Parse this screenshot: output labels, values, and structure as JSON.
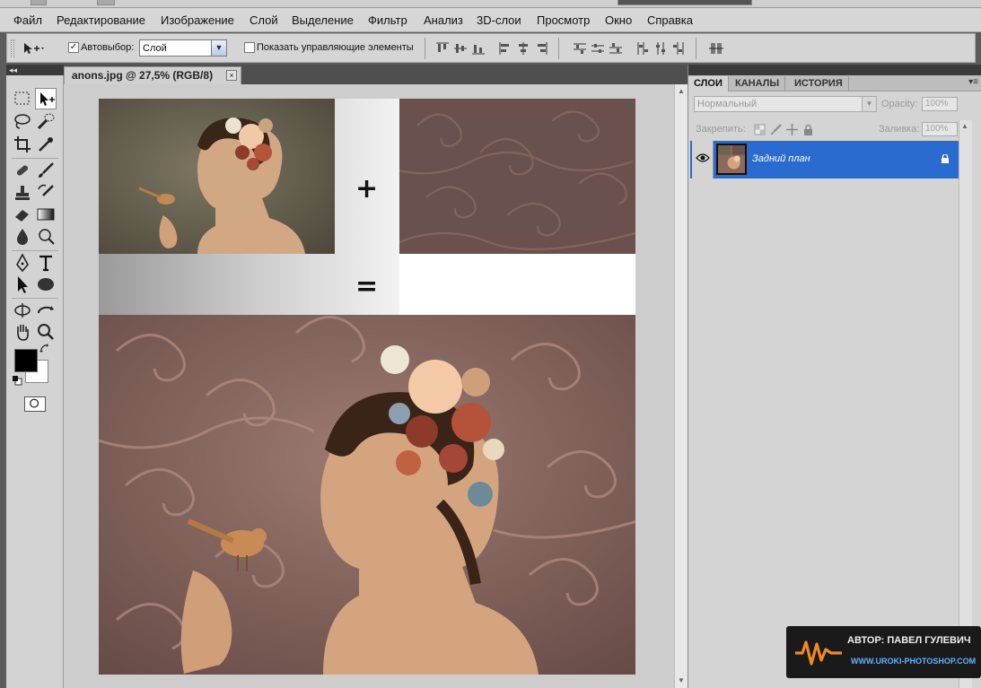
{
  "menu": [
    "Файл",
    "Редактирование",
    "Изображение",
    "Слой",
    "Выделение",
    "Фильтр",
    "Анализ",
    "3D-слои",
    "Просмотр",
    "Окно",
    "Справка"
  ],
  "options": {
    "autoselect_label": "Автовыбор:",
    "autoselect_checked": true,
    "autoselect_value": "Слой",
    "show_controls_label": "Показать управляющие элементы",
    "show_controls_checked": false
  },
  "document": {
    "tab_title": "anons.jpg @ 27,5% (RGB/8)",
    "close_glyph": "×",
    "plus_symbol": "+",
    "equals_symbol": "="
  },
  "layers_panel": {
    "tabs": [
      "СЛОИ",
      "КАНАЛЫ",
      "ИСТОРИЯ"
    ],
    "active_tab": "СЛОИ",
    "blend_mode": "Нормальный",
    "opacity_label": "Opacity:",
    "opacity_value": "100%",
    "lock_label": "Закрепить:",
    "fill_label": "Заливка:",
    "fill_value": "100%",
    "layers": [
      {
        "name": "Задний план",
        "visible": true,
        "locked": true,
        "selected": true
      }
    ]
  },
  "tools": {
    "foreground_color": "#000000",
    "background_color": "#ffffff"
  },
  "watermark": {
    "author": "АВТОР: ПАВЕЛ ГУЛЕВИЧ",
    "url": "WWW.UROKI-PHOTOSHOP.COM"
  },
  "colors": {
    "accent_selection": "#2a6bd0",
    "texture": "#6e5450"
  }
}
